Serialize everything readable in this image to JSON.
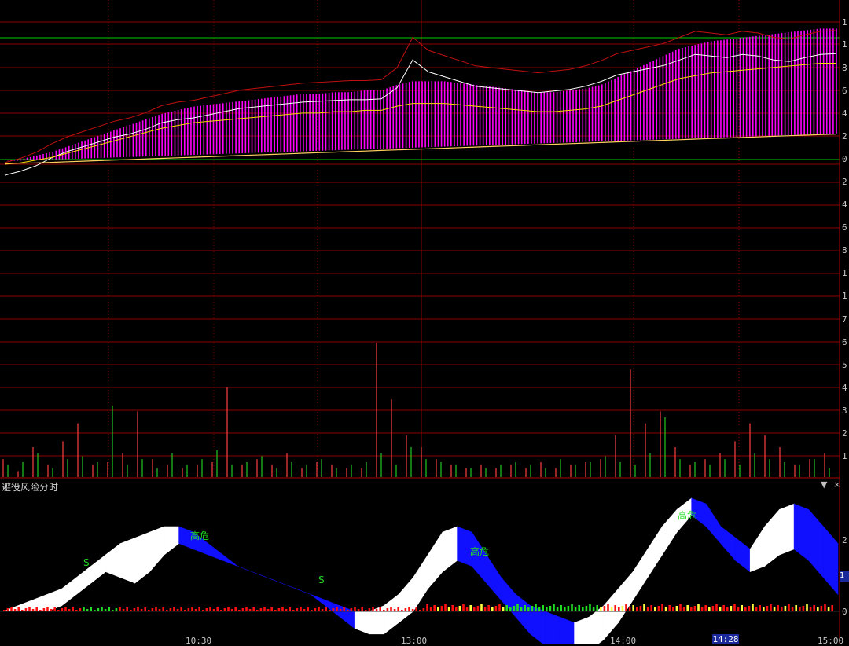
{
  "indicator_title": "避役风险分时",
  "controls": {
    "dropdown_glyph": "▼",
    "close_glyph": "×"
  },
  "time_axis": {
    "labels": [
      "10:30",
      "13:00",
      "14:00",
      "14:28",
      "15:00"
    ],
    "cursor_time": "14:28"
  },
  "right_axis_labels": [
    "1",
    "1",
    "8",
    "6",
    "4",
    "2",
    "0",
    "2",
    "4",
    "6",
    "8",
    "1",
    "1",
    "7",
    "6",
    "5",
    "4",
    "3",
    "2",
    "1"
  ],
  "indicator_axis_labels": [
    "2",
    "0"
  ],
  "indicator_side_value": "1",
  "signals": [
    {
      "text": "S",
      "color": "#22dd22"
    },
    {
      "text": "高危",
      "color": "#22dd22"
    },
    {
      "text": "S",
      "color": "#22dd22"
    },
    {
      "text": "高危",
      "color": "#22dd22"
    },
    {
      "text": "高危",
      "color": "#22dd22"
    }
  ],
  "colors": {
    "background": "#000000",
    "grid": "#8b0000",
    "price_line": "#ffffff",
    "avg_line": "#ffd700",
    "band_line": "#c01010",
    "histogram": "#ff00ff",
    "zero_line": "#00cc00",
    "up_volume": "#ff4040",
    "down_volume": "#22c822",
    "rise_fill": "#ffffff",
    "fall_fill": "#1010ff",
    "osc_red": "#ff1010",
    "osc_yellow": "#ffff40",
    "osc_green": "#22dd22"
  },
  "chart_data": {
    "type": "line",
    "sessions": [
      "09:30-11:30",
      "13:00-15:00"
    ],
    "series": [
      {
        "values": [
          0,
          5,
          12,
          22,
          30,
          36,
          42,
          48,
          52,
          58,
          66,
          70,
          72,
          76,
          80,
          84,
          86,
          88,
          90,
          92,
          93,
          94,
          95,
          95,
          96,
          110,
          145,
          130,
          124,
          118,
          112,
          110,
          108,
          106,
          104,
          106,
          108,
          112,
          118,
          126,
          130,
          134,
          138,
          145,
          152,
          150,
          148,
          152,
          150,
          145,
          143,
          148,
          152,
          153
        ]
      },
      {
        "values": [
          0,
          1,
          3,
          5,
          8,
          11,
          14,
          17,
          20,
          23,
          26,
          28,
          30,
          31,
          32,
          33,
          34,
          35,
          36,
          37,
          37,
          38,
          38,
          39,
          39,
          42,
          44,
          44,
          44,
          43,
          42,
          41,
          40,
          39,
          38,
          38,
          39,
          40,
          42,
          46,
          50,
          54,
          58,
          62,
          64,
          66,
          67,
          68,
          69,
          70,
          71,
          72,
          73,
          73
        ]
      },
      {
        "values": [
          0,
          1,
          2,
          4,
          6,
          8,
          10,
          12,
          14,
          16,
          18,
          20,
          22,
          24,
          26,
          28,
          30,
          32,
          34,
          36,
          38,
          40,
          42,
          44,
          46,
          48,
          50,
          52,
          54,
          56,
          58,
          60,
          62,
          64,
          66,
          68,
          70,
          72,
          74,
          76,
          78,
          80,
          82,
          84,
          86,
          88,
          90,
          92,
          94,
          96,
          98,
          100,
          102,
          104
        ]
      }
    ],
    "volume": {
      "up": [
        6,
        2,
        10,
        4,
        12,
        18,
        4,
        5,
        8,
        22,
        6,
        4,
        3,
        4,
        5,
        30,
        4,
        6,
        4,
        8,
        3,
        5,
        4,
        3,
        3,
        45,
        26,
        14,
        10,
        6,
        4,
        3,
        4,
        3,
        4,
        3,
        5,
        3,
        4,
        5,
        6,
        14,
        36,
        18,
        22,
        10,
        4,
        6,
        8,
        12,
        18,
        14,
        10,
        4,
        6,
        8
      ],
      "down": [
        4,
        5,
        8,
        3,
        6,
        7,
        5,
        24,
        4,
        6,
        3,
        8,
        4,
        6,
        9,
        4,
        5,
        7,
        3,
        5,
        4,
        6,
        3,
        4,
        5,
        8,
        4,
        10,
        6,
        5,
        4,
        3,
        3,
        4,
        5,
        4,
        3,
        6,
        4,
        5,
        7,
        5,
        4,
        8,
        20,
        6,
        5,
        4,
        6,
        4,
        8,
        6,
        5,
        4,
        6,
        3
      ]
    },
    "oscillator": {
      "rise": [
        0,
        2,
        4,
        6,
        8,
        12,
        16,
        20,
        24,
        26,
        28,
        30,
        30,
        28,
        24,
        20,
        16,
        14,
        12,
        10,
        8,
        6,
        4,
        2,
        0,
        0,
        2,
        6,
        12,
        20,
        28,
        30,
        28,
        20,
        12,
        6,
        2,
        0,
        -2,
        -4,
        -2,
        2,
        8,
        14,
        22,
        30,
        36,
        40,
        38,
        30,
        26,
        22,
        30,
        36,
        38,
        36,
        30,
        24
      ],
      "fall": [
        0,
        0,
        0,
        0,
        2,
        6,
        10,
        14,
        12,
        10,
        14,
        20,
        24,
        22,
        20,
        18,
        16,
        14,
        12,
        10,
        8,
        6,
        2,
        -2,
        -6,
        -8,
        -8,
        -4,
        0,
        8,
        14,
        18,
        16,
        10,
        4,
        -2,
        -8,
        -12,
        -14,
        -16,
        -14,
        -10,
        -4,
        4,
        12,
        20,
        28,
        34,
        30,
        24,
        18,
        14,
        16,
        20,
        22,
        18,
        12,
        6
      ]
    }
  }
}
